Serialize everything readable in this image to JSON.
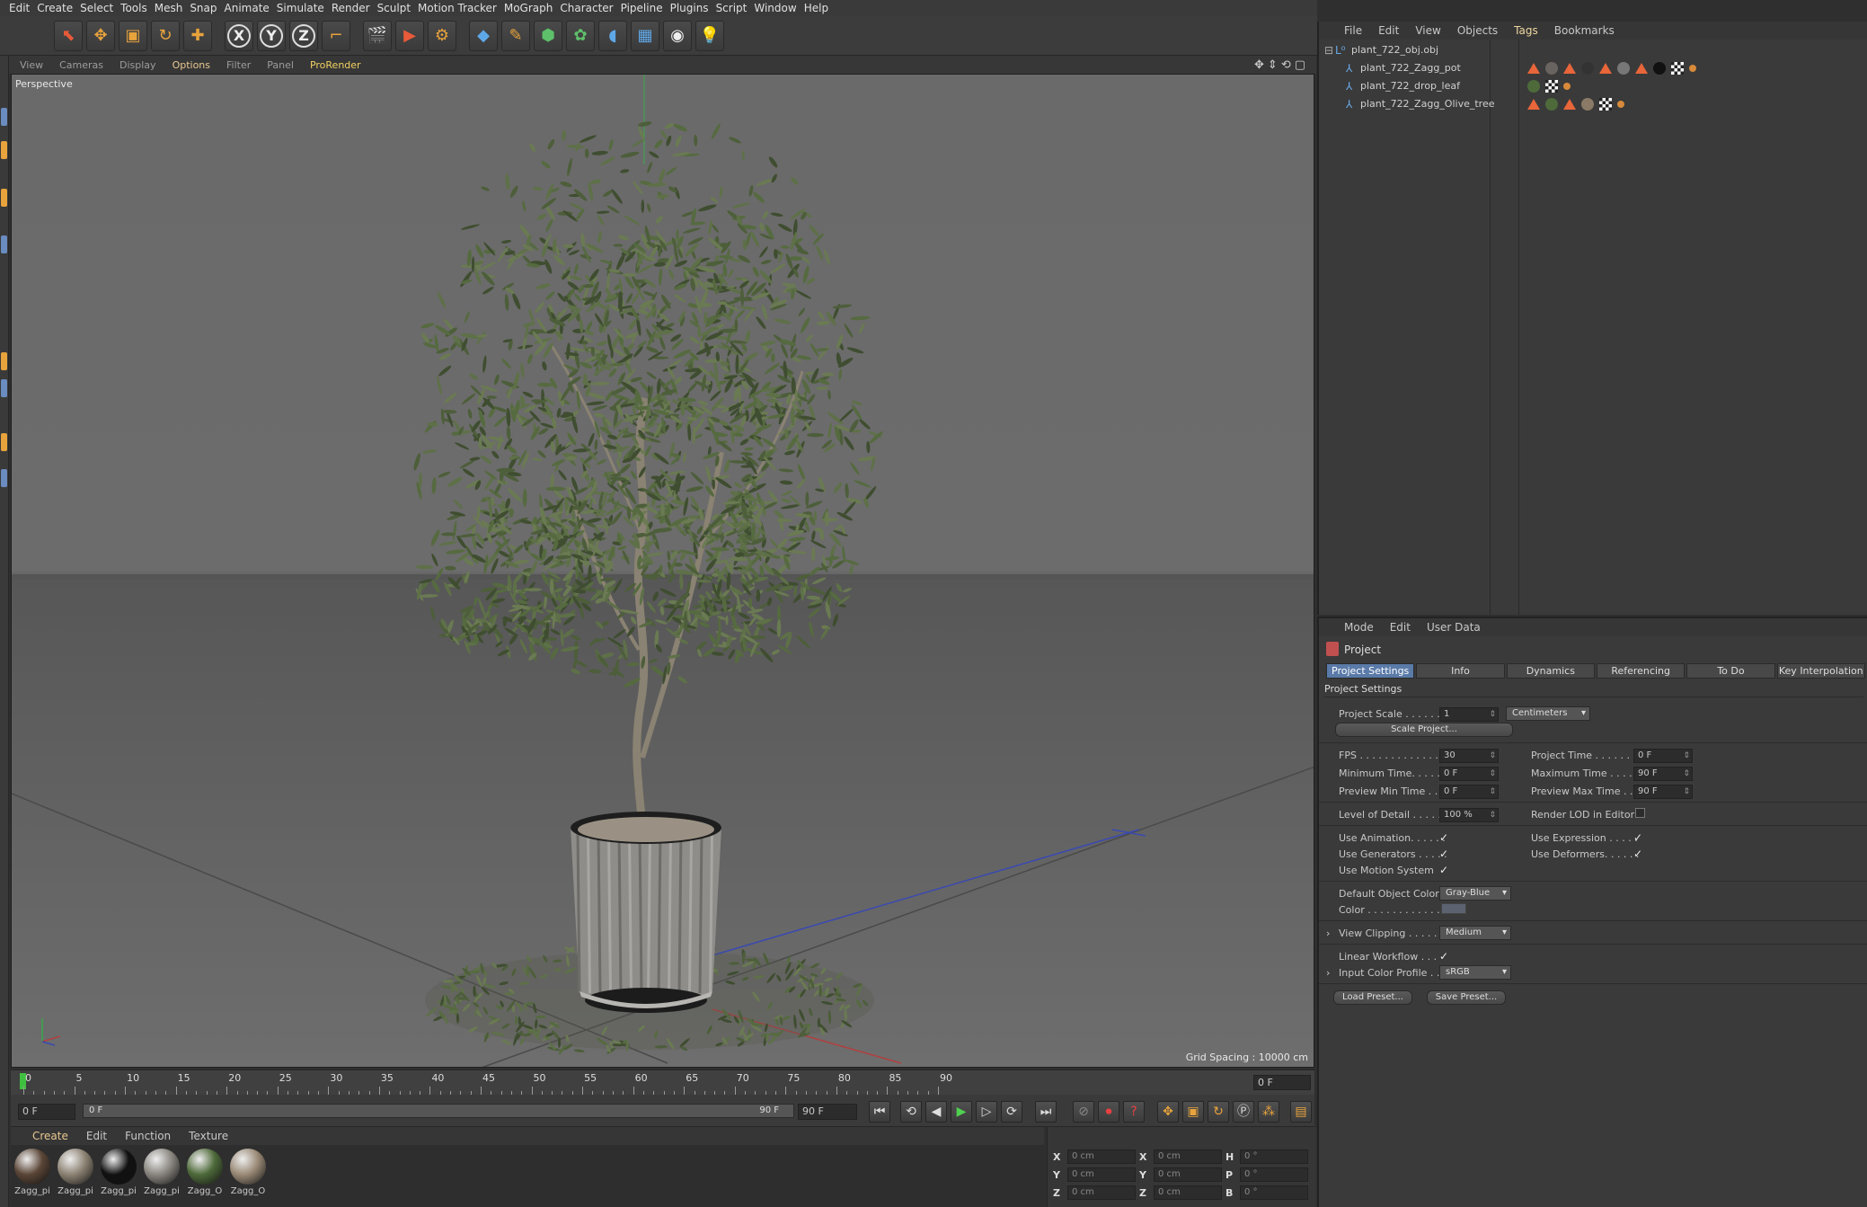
{
  "menu": [
    "Edit",
    "Create",
    "Select",
    "Tools",
    "Mesh",
    "Snap",
    "Animate",
    "Simulate",
    "Render",
    "Sculpt",
    "Motion Tracker",
    "MoGraph",
    "Character",
    "Pipeline",
    "Plugins",
    "Script",
    "Window",
    "Help"
  ],
  "toolbar": {
    "tools": [
      "cursor-icon",
      "move-icon",
      "scale-icon",
      "rotate-icon",
      "plus-icon"
    ],
    "axes": [
      "X",
      "Y",
      "Z"
    ],
    "render": [
      "clapperboard-icon",
      "render-view-icon",
      "render-settings-icon"
    ],
    "objects": [
      "cube-icon",
      "pen-icon",
      "subdivision-icon",
      "cloner-icon",
      "deformer-icon",
      "floor-icon",
      "camera-icon",
      "light-icon"
    ]
  },
  "viewport": {
    "menu": [
      "View",
      "Cameras",
      "Display",
      "Options",
      "Filter",
      "Panel",
      "ProRender"
    ],
    "label": "Perspective",
    "grid_spacing": "Grid Spacing : 10000 cm"
  },
  "timeline": {
    "ticks": [
      "0",
      "5",
      "10",
      "15",
      "20",
      "25",
      "30",
      "35",
      "40",
      "45",
      "50",
      "55",
      "60",
      "65",
      "70",
      "75",
      "80",
      "85",
      "90"
    ],
    "current_frame": "0 F",
    "start": "0 F",
    "range_start": "0 F",
    "range_end": "90 F",
    "end": "90 F"
  },
  "materials": {
    "menu": [
      "Create",
      "Edit",
      "Function",
      "Texture"
    ],
    "items": [
      {
        "label": "Zagg_pi",
        "color": "#5a4536"
      },
      {
        "label": "Zagg_pi",
        "color": "#8c8273"
      },
      {
        "label": "Zagg_pi",
        "color": "#111111"
      },
      {
        "label": "Zagg_pi",
        "color": "#8a8680"
      },
      {
        "label": "Zagg_O",
        "color": "#4e6a3a"
      },
      {
        "label": "Zagg_O",
        "color": "#9a8a76"
      }
    ]
  },
  "coords": {
    "rows": [
      {
        "a": "X",
        "av": "0 cm",
        "b": "X",
        "bv": "0 cm",
        "c": "H",
        "cv": "0 °"
      },
      {
        "a": "Y",
        "av": "0 cm",
        "b": "Y",
        "bv": "0 cm",
        "c": "P",
        "cv": "0 °"
      },
      {
        "a": "Z",
        "av": "0 cm",
        "b": "Z",
        "bv": "0 cm",
        "c": "B",
        "cv": "0 °"
      }
    ]
  },
  "objects": {
    "menu": [
      "File",
      "Edit",
      "View",
      "Objects",
      "Tags",
      "Bookmarks"
    ],
    "items": [
      {
        "name": "plant_722_obj.obj"
      },
      {
        "name": "plant_722_Zagg_pot"
      },
      {
        "name": "plant_722_drop_leaf"
      },
      {
        "name": "plant_722_Zagg_Olive_tree"
      }
    ]
  },
  "attributes": {
    "menu": [
      "Mode",
      "Edit",
      "User Data"
    ],
    "title": "Project",
    "tabs": [
      "Project Settings",
      "Info",
      "Dynamics",
      "Referencing",
      "To Do",
      "Key Interpolation"
    ],
    "section": "Project Settings",
    "project_scale_label": "Project Scale . . . . . .",
    "project_scale_value": "1",
    "project_scale_unit": "Centimeters",
    "scale_project_btn": "Scale Project...",
    "fps_label": "FPS . . . . . . . . . . . . . .",
    "fps_value": "30",
    "project_time_label": "Project Time . . . . . . . .",
    "project_time_value": "0 F",
    "min_time_label": "Minimum Time. . . . . .",
    "min_time_value": "0 F",
    "max_time_label": "Maximum Time . . . . .",
    "max_time_value": "90 F",
    "prev_min_label": "Preview Min Time . .",
    "prev_min_value": "0 F",
    "prev_max_label": "Preview Max Time . .",
    "prev_max_value": "90 F",
    "lod_label": "Level of Detail . . . . .",
    "lod_value": "100 %",
    "render_lod_label": "Render LOD in Editor",
    "use_anim_label": "Use Animation. . . . . .",
    "use_expr_label": "Use Expression . . . . .",
    "use_gen_label": "Use Generators . . . . .",
    "use_def_label": "Use Deformers. . . . . .",
    "use_motion_label": "Use Motion System",
    "def_color_label": "Default Object Color",
    "def_color_value": "Gray-Blue",
    "color_label": "Color . . . . . . . . . . . .",
    "view_clip_label": "View Clipping . . . . .",
    "view_clip_value": "Medium",
    "linear_label": "Linear Workflow . . .",
    "input_profile_label": "Input Color Profile . .",
    "input_profile_value": "sRGB",
    "load_preset": "Load Preset...",
    "save_preset": "Save Preset..."
  }
}
